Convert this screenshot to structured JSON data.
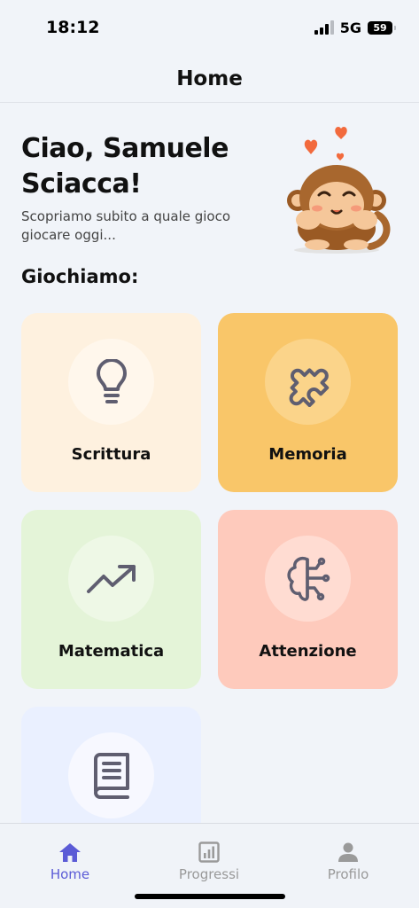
{
  "status_bar": {
    "time": "18:12",
    "network": "5G",
    "battery": "59"
  },
  "header": {
    "title": "Home"
  },
  "greeting": {
    "title": "Ciao, Samuele Sciacca!",
    "subtitle": "Scopriamo subito a quale gioco giocare oggi..."
  },
  "section_title": "Giochiamo:",
  "games": [
    {
      "label": "Scrittura",
      "icon": "lightbulb-icon",
      "color": "#fef1df"
    },
    {
      "label": "Memoria",
      "icon": "puzzle-icon",
      "color": "#f9c669"
    },
    {
      "label": "Matematica",
      "icon": "trending-up-icon",
      "color": "#e4f4d8"
    },
    {
      "label": "Attenzione",
      "icon": "brain-icon",
      "color": "#fecabc"
    },
    {
      "label": "",
      "icon": "book-icon",
      "color": "#eaf0ff"
    }
  ],
  "nav": [
    {
      "label": "Home",
      "icon": "home-icon",
      "active": true,
      "color": "#5b5bd6"
    },
    {
      "label": "Progressi",
      "icon": "chart-icon",
      "active": false
    },
    {
      "label": "Profilo",
      "icon": "user-icon",
      "active": false
    }
  ]
}
